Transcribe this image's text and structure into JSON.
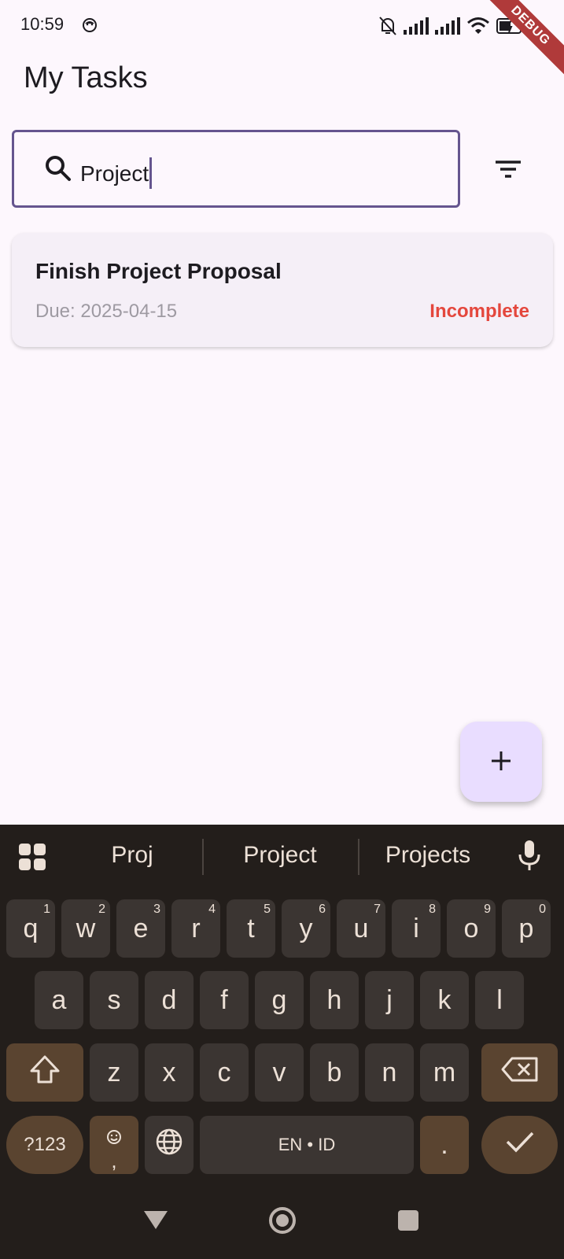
{
  "status_bar": {
    "time": "10:59",
    "debug_label": "DEBUG"
  },
  "header": {
    "title": "My Tasks"
  },
  "search": {
    "value": "Project"
  },
  "tasks": [
    {
      "title": "Finish Project Proposal",
      "due": "Due: 2025-04-15",
      "status": "Incomplete"
    }
  ],
  "keyboard": {
    "suggestions": [
      "Proj",
      "Project",
      "Projects"
    ],
    "row1": [
      {
        "k": "q",
        "n": "1"
      },
      {
        "k": "w",
        "n": "2"
      },
      {
        "k": "e",
        "n": "3"
      },
      {
        "k": "r",
        "n": "4"
      },
      {
        "k": "t",
        "n": "5"
      },
      {
        "k": "y",
        "n": "6"
      },
      {
        "k": "u",
        "n": "7"
      },
      {
        "k": "i",
        "n": "8"
      },
      {
        "k": "o",
        "n": "9"
      },
      {
        "k": "p",
        "n": "0"
      }
    ],
    "row2": [
      "a",
      "s",
      "d",
      "f",
      "g",
      "h",
      "j",
      "k",
      "l"
    ],
    "row3": [
      "z",
      "x",
      "c",
      "v",
      "b",
      "n",
      "m"
    ],
    "symbols_label": "?123",
    "comma_label": ",",
    "space_label": "EN • ID",
    "period_label": "."
  },
  "colors": {
    "accent": "#65558f",
    "incomplete": "#e4473d",
    "fab": "#e9ddff"
  }
}
